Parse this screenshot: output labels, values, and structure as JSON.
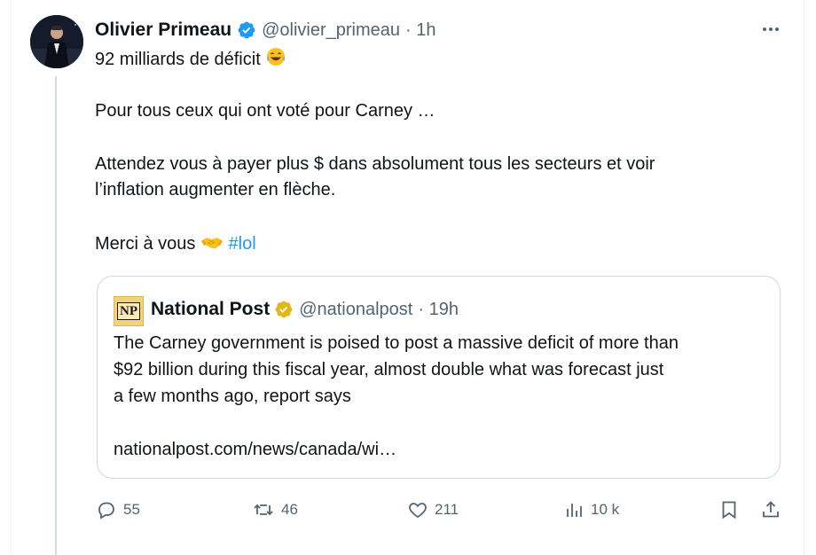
{
  "tweet": {
    "author_name": "Olivier Primeau",
    "handle": "@olivier_primeau",
    "time": "· 1h",
    "lines": [
      "92 milliards de déficit",
      "Pour tous ceux qui ont voté pour Carney …",
      "Attendez vous à payer plus $ dans absolument tous les secteurs et voir",
      "l’inflation augmenter en flèche.",
      "Merci à vous"
    ],
    "hashtag": "#lol",
    "emojis": [
      "face-with-tears-of-joy-emoji",
      "handshake-emoji"
    ]
  },
  "quote": {
    "logo_text": "NP",
    "author_name": "National Post",
    "handle": "@nationalpost",
    "time": "· 19h",
    "lines": [
      "The Carney government is poised to post a massive deficit of more than",
      "$92 billion during this fiscal year, almost  double what was forecast just",
      "a few months ago, report says",
      "nationalpost.com/news/canada/wi…"
    ]
  },
  "actions": {
    "replies": "55",
    "reposts": "46",
    "likes": "211",
    "views": "10 k"
  },
  "colors": {
    "verified_blue": "#1d9bf0",
    "verified_gold": "#e2b719",
    "hashtag": "#1d9bf0",
    "muted_text": "#536471"
  }
}
